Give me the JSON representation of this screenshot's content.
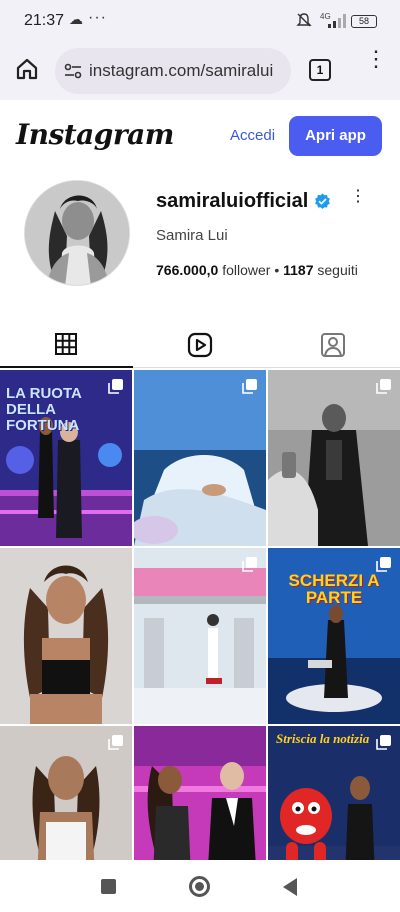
{
  "status_bar": {
    "time": "21:37",
    "battery": "58",
    "network": "4G"
  },
  "browser": {
    "url": "instagram.com/samiralui",
    "tab_count": "1"
  },
  "header": {
    "logo": "Instagram",
    "login_label": "Accedi",
    "open_app_label": "Apri app",
    "accent_color": "#4a5df0"
  },
  "profile": {
    "username": "samiraluiofficial",
    "full_name": "Samira Lui",
    "followers_value": "766.000,0",
    "followers_label": "follower",
    "following_value": "1187",
    "following_label": "seguiti"
  },
  "tabs": [
    {
      "icon": "grid-icon",
      "active": true
    },
    {
      "icon": "reels-icon",
      "active": false
    },
    {
      "icon": "tagged-icon",
      "active": false
    }
  ],
  "posts": [
    {
      "title": "LA RUOTA DELLA FORTUNA",
      "multi": true
    },
    {
      "title": "",
      "multi": true
    },
    {
      "title": "",
      "multi": true
    },
    {
      "title": "",
      "multi": false
    },
    {
      "title": "",
      "multi": true
    },
    {
      "title": "SCHERZI A PARTE",
      "multi": true
    },
    {
      "title": "",
      "multi": true
    },
    {
      "title": "",
      "multi": false
    },
    {
      "title": "Striscia la notizia",
      "multi": true
    }
  ]
}
